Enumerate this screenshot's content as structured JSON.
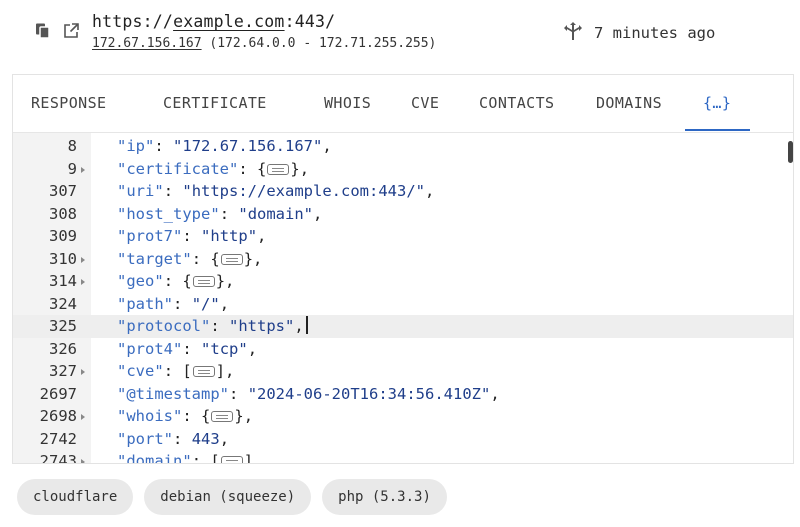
{
  "header": {
    "url_prefix": "https://",
    "url_host": "example.com",
    "url_suffix": ":443/",
    "ip": "172.67.156.167",
    "ip_range": " (172.64.0.0 - 172.71.255.255)",
    "last_seen": "7 minutes ago",
    "icons": [
      "copy-icon",
      "open-external-icon",
      "route-icon"
    ]
  },
  "tabs": [
    {
      "label": "RESPONSE"
    },
    {
      "label": "CERTIFICATE"
    },
    {
      "label": "WHOIS"
    },
    {
      "label": "CVE"
    },
    {
      "label": "CONTACTS"
    },
    {
      "label": "DOMAINS"
    },
    {
      "label": "{…}",
      "active": true
    }
  ],
  "editor": {
    "active_line": 325,
    "lines": [
      {
        "num": "8",
        "fold": false,
        "key": "ip",
        "kind": "string",
        "value": "\"172.67.156.167\""
      },
      {
        "num": "9",
        "fold": true,
        "key": "certificate",
        "kind": "object"
      },
      {
        "num": "307",
        "fold": false,
        "key": "uri",
        "kind": "string",
        "value": "\"https://example.com:443/\""
      },
      {
        "num": "308",
        "fold": false,
        "key": "host_type",
        "kind": "string",
        "value": "\"domain\""
      },
      {
        "num": "309",
        "fold": false,
        "key": "prot7",
        "kind": "string",
        "value": "\"http\""
      },
      {
        "num": "310",
        "fold": true,
        "key": "target",
        "kind": "object"
      },
      {
        "num": "314",
        "fold": true,
        "key": "geo",
        "kind": "object"
      },
      {
        "num": "324",
        "fold": false,
        "key": "path",
        "kind": "string",
        "value": "\"/\""
      },
      {
        "num": "325",
        "fold": false,
        "key": "protocol",
        "kind": "string",
        "value": "\"https\""
      },
      {
        "num": "326",
        "fold": false,
        "key": "prot4",
        "kind": "string",
        "value": "\"tcp\""
      },
      {
        "num": "327",
        "fold": true,
        "key": "cve",
        "kind": "array"
      },
      {
        "num": "2697",
        "fold": false,
        "key": "@timestamp",
        "kind": "string",
        "value": "\"2024-06-20T16:34:56.410Z\""
      },
      {
        "num": "2698",
        "fold": true,
        "key": "whois",
        "kind": "object"
      },
      {
        "num": "2742",
        "fold": false,
        "key": "port",
        "kind": "number",
        "value": "443"
      },
      {
        "num": "2743",
        "fold": true,
        "key": "domain",
        "kind": "array"
      }
    ]
  },
  "tags": [
    "cloudflare",
    "debian (squeeze)",
    "php (5.3.3)"
  ],
  "colors": {
    "accent": "#2d67c4",
    "key": "#3b6cbf",
    "value": "#1f3e8a"
  }
}
